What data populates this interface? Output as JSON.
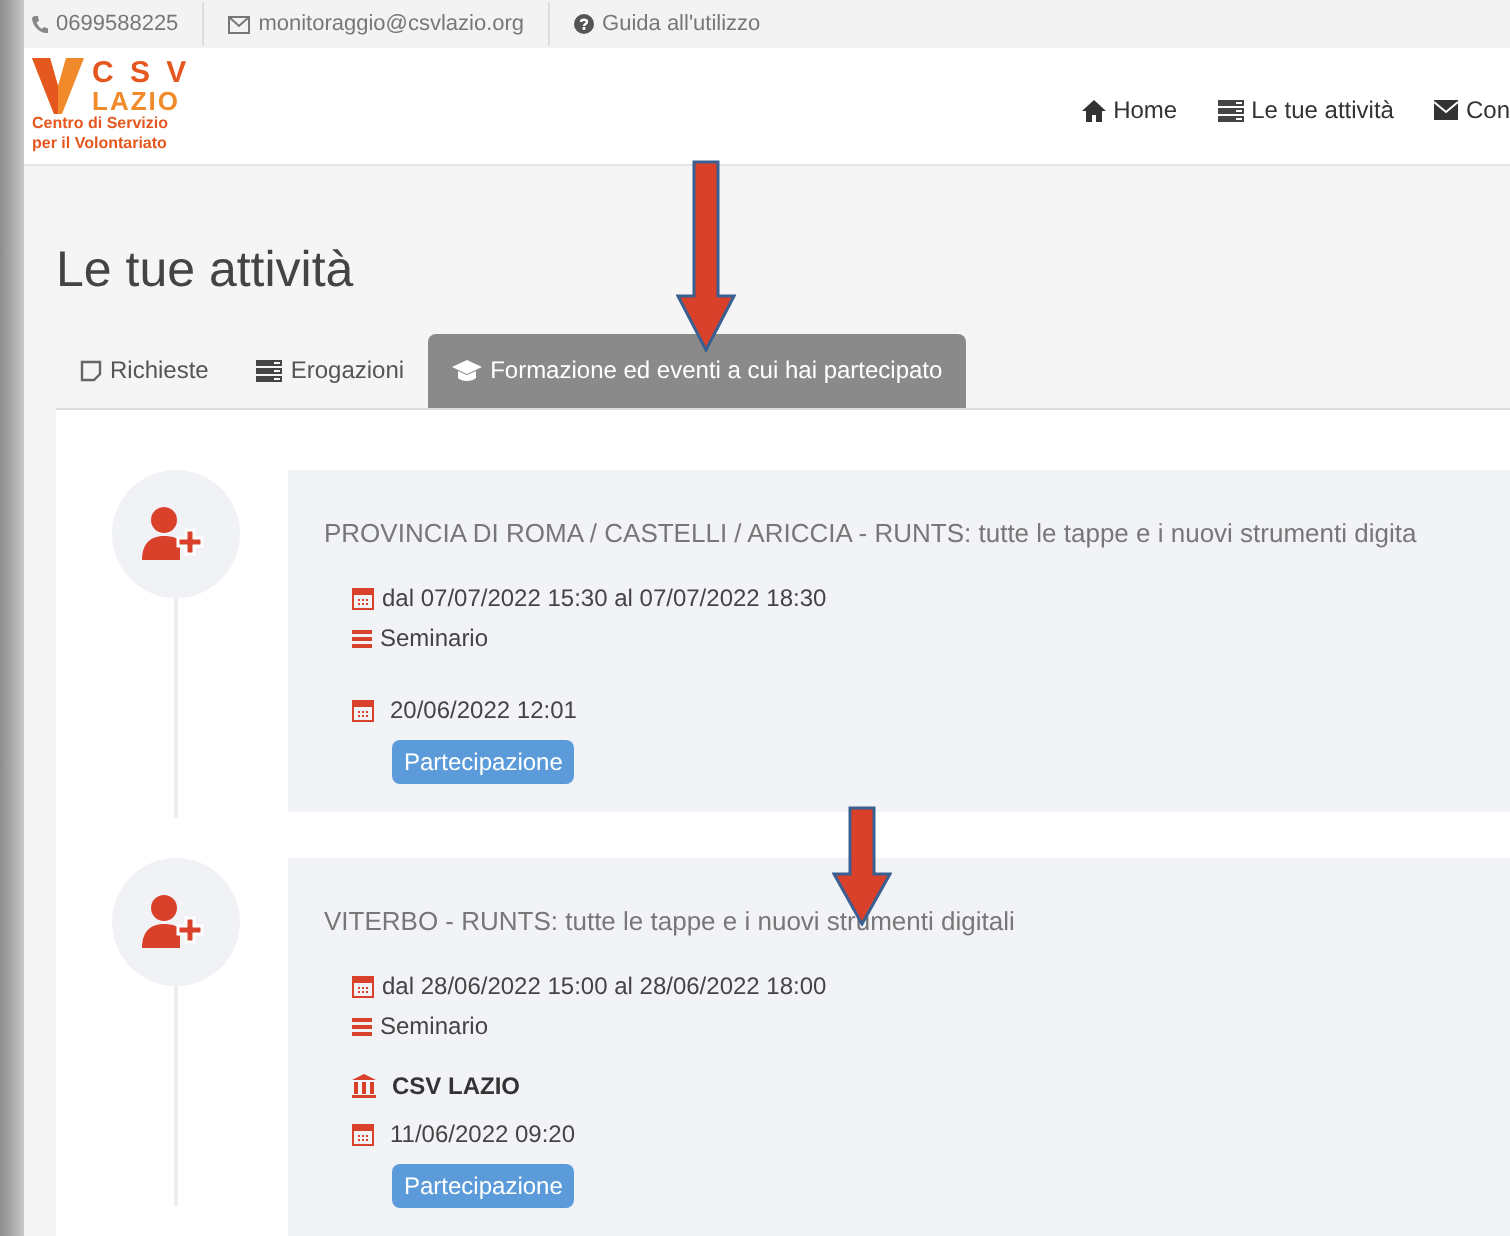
{
  "top_bar": {
    "phone": "0699588225",
    "email": "monitoraggio@csvlazio.org",
    "guide": "Guida all'utilizzo"
  },
  "logo": {
    "name": "C S V",
    "region": "LAZIO",
    "line_1": "Centro di Servizio",
    "line_2": "per il Volontariato"
  },
  "nav": [
    {
      "label": "Home"
    },
    {
      "label": "Le tue attività"
    },
    {
      "label": "Con"
    }
  ],
  "page_title": "Le tue attività",
  "tabs": [
    {
      "label": "Richieste",
      "selected": false
    },
    {
      "label": "Erogazioni",
      "selected": false
    },
    {
      "label": "Formazione ed eventi a cui hai partecipato",
      "selected": true
    }
  ],
  "events": [
    {
      "title": "PROVINCIA DI ROMA / CASTELLI / ARICCIA - RUNTS: tutte le tappe e i nuovi strumenti digita",
      "period": "dal 07/07/2022 15:30 al 07/07/2022 18:30",
      "type": "Seminario",
      "registered": "20/06/2022 12:01",
      "badge": "Partecipazione"
    },
    {
      "title": "VITERBO - RUNTS: tutte le tappe e i nuovi strumenti digitali",
      "period": "dal 28/06/2022 15:00 al 28/06/2022 18:00",
      "type": "Seminario",
      "organizer": "CSV LAZIO",
      "registered": "11/06/2022 09:20",
      "badge": "Partecipazione"
    }
  ]
}
